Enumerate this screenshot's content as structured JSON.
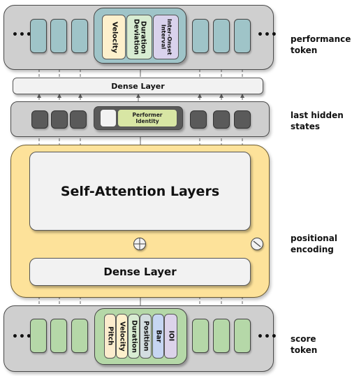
{
  "labels": {
    "performance_token": "performance\ntoken",
    "last_hidden_states": "last hidden\nstates",
    "positional_encoding": "positional\nencoding",
    "score_token": "score\ntoken"
  },
  "ellipsis": "•••",
  "performance_features": [
    {
      "label": "Velocity",
      "color": "#fdf0cc"
    },
    {
      "label": "Duration\nDeviation",
      "color": "#d8ecd2"
    },
    {
      "label": "Inter-Onset\nInterval",
      "color": "#d9d2ec"
    }
  ],
  "dense_layer_top": "Dense Layer",
  "performer_identity": "Performer\nIdentity",
  "self_attention": "Self-Attention Layers",
  "dense_layer_bottom": "Dense Layer",
  "score_features": [
    {
      "label": "Pitch",
      "color": "#fbeccd"
    },
    {
      "label": "Velocity",
      "color": "#fdf0cc"
    },
    {
      "label": "Duration",
      "color": "#d8ecd2"
    },
    {
      "label": "Position",
      "color": "#d3dde0"
    },
    {
      "label": "Bar",
      "color": "#c6d6f2"
    },
    {
      "label": "IOI",
      "color": "#dcd3ea"
    }
  ],
  "colors": {
    "performance_token": "#9fc4c8",
    "score_token": "#b5d8a8",
    "hidden_state": "#5a5a5a",
    "encoder_background": "#fde29a",
    "performer_identity": "#d8e6a4"
  }
}
